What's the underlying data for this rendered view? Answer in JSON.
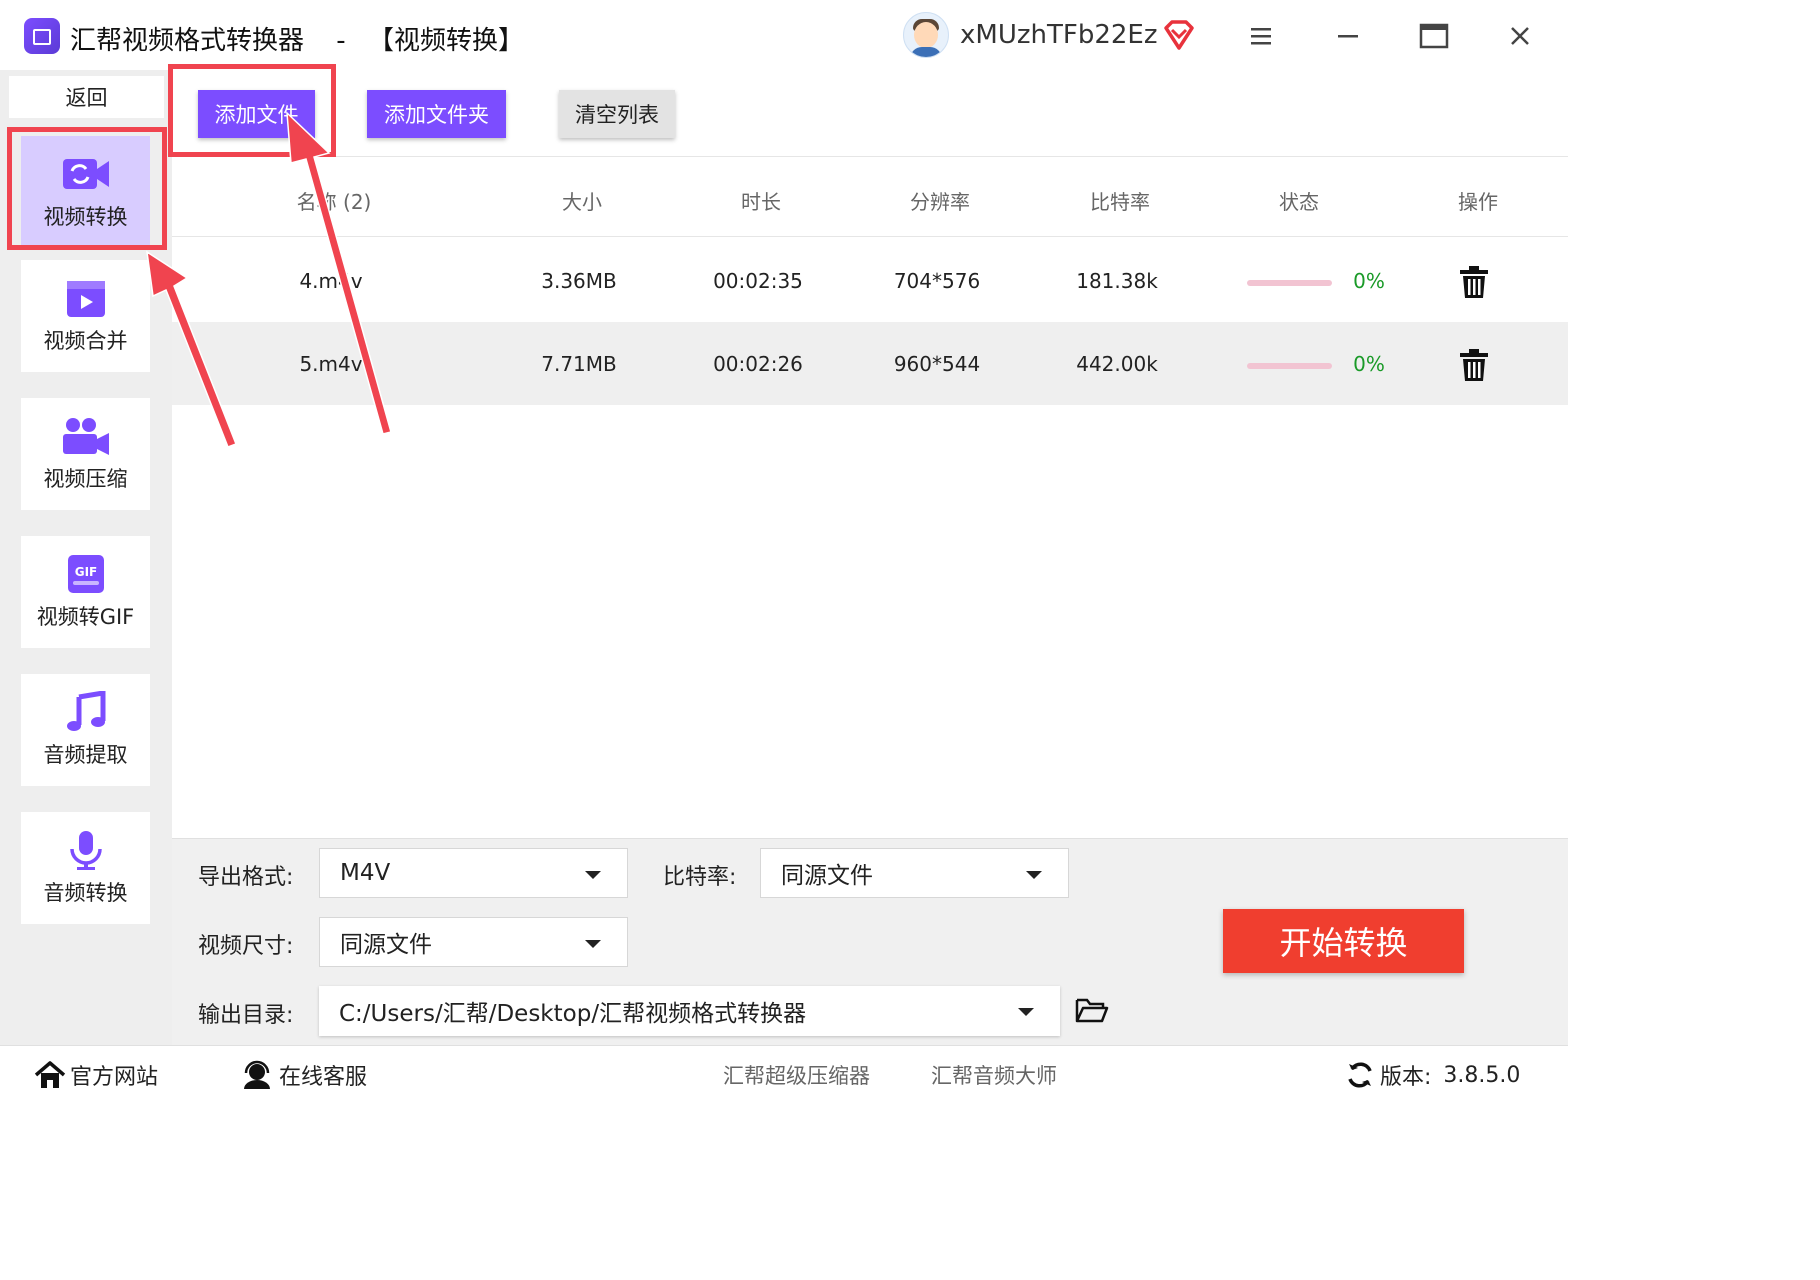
{
  "window": {
    "app_name": "汇帮视频格式转换器",
    "separator": "-",
    "section": "【视频转换】",
    "username": "xMUzhTFb22Ez",
    "icons": [
      "vip-diamond-icon",
      "menu-icon",
      "minimize-icon",
      "maximize-icon",
      "close-icon"
    ]
  },
  "sidebar": {
    "back_label": "返回",
    "items": [
      {
        "label": "视频转换",
        "icon": "video-convert-icon",
        "active": true
      },
      {
        "label": "视频合并",
        "icon": "video-merge-icon",
        "active": false
      },
      {
        "label": "视频压缩",
        "icon": "video-compress-icon",
        "active": false
      },
      {
        "label": "视频转GIF",
        "icon": "gif-icon",
        "active": false
      },
      {
        "label": "音频提取",
        "icon": "music-note-icon",
        "active": false
      },
      {
        "label": "音频转换",
        "icon": "microphone-icon",
        "active": false
      }
    ]
  },
  "toolbar": {
    "add_file": "添加文件",
    "add_folder": "添加文件夹",
    "clear_list": "清空列表"
  },
  "table": {
    "headers": [
      "名称 (2)",
      "大小",
      "时长",
      "分辨率",
      "比特率",
      "状态",
      "操作"
    ],
    "rows": [
      {
        "name": "4.m4v",
        "size": "3.36MB",
        "duration": "00:02:35",
        "resolution": "704*576",
        "bitrate": "181.38k",
        "progress": 0,
        "status": "0%"
      },
      {
        "name": "5.m4v",
        "size": "7.71MB",
        "duration": "00:02:26",
        "resolution": "960*544",
        "bitrate": "442.00k",
        "progress": 0,
        "status": "0%"
      }
    ]
  },
  "settings": {
    "format_label": "导出格式:",
    "format_value": "M4V",
    "bitrate_label": "比特率:",
    "bitrate_value": "同源文件",
    "size_label": "视频尺寸:",
    "size_value": "同源文件",
    "output_label": "输出目录:",
    "output_value": "C:/Users/汇帮/Desktop/汇帮视频格式转换器",
    "start_button": "开始转换"
  },
  "footer": {
    "website": "官方网站",
    "support": "在线客服",
    "link1": "汇帮超级压缩器",
    "link2": "汇帮音频大师",
    "version_label": "版本:",
    "version": "3.8.5.0"
  },
  "colors": {
    "accent": "#7c4dff",
    "start": "#f03e2f",
    "highlight": "#f0444f",
    "progress": "#f2c4d2",
    "percent": "#1a9a28"
  }
}
